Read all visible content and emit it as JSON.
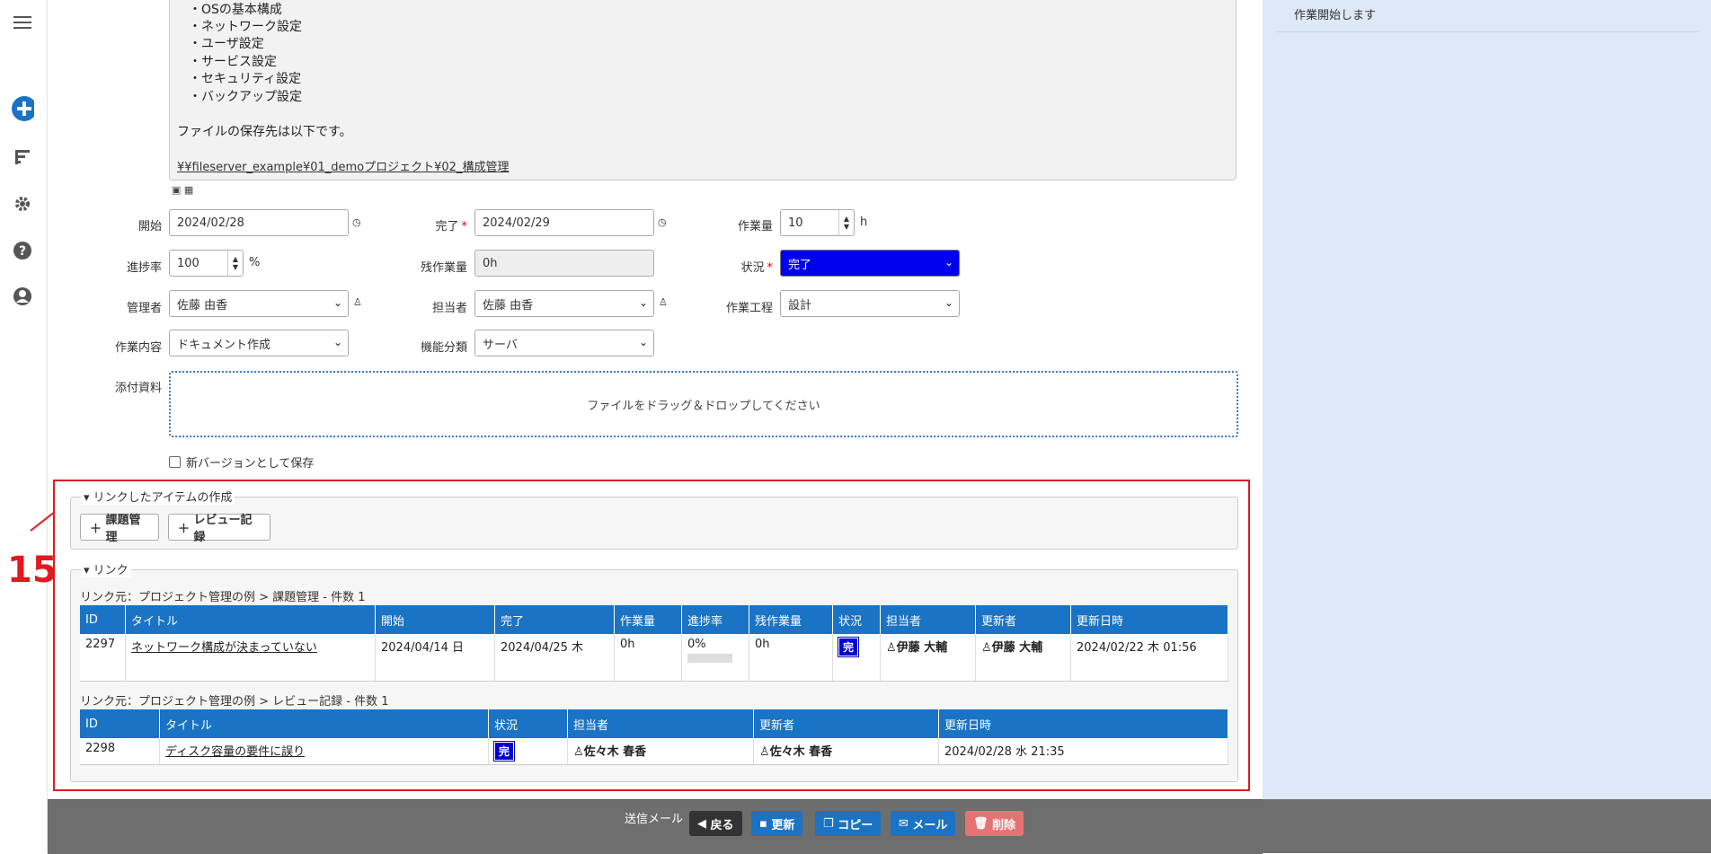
{
  "nav": {
    "icons": [
      "menu-icon",
      "add-icon",
      "gantt-icon",
      "gear-icon",
      "help-icon",
      "user-icon"
    ]
  },
  "description": {
    "lines": [
      "・OSの基本構成",
      "・ネットワーク設定",
      "・ユーザ設定",
      "・サービス設定",
      "・セキュリティ設定",
      "・バックアップ設定"
    ],
    "storage_text": "ファイルの保存先は以下です。",
    "path": "¥¥fileserver_example¥01_demoプロジェクト¥02_構成管理"
  },
  "right_panel": {
    "comment": "作業開始します"
  },
  "form": {
    "start": {
      "label": "開始",
      "value": "2024/02/28"
    },
    "end": {
      "label": "完了",
      "value": "2024/02/29"
    },
    "workload": {
      "label": "作業量",
      "value": "10",
      "unit": "h"
    },
    "progress": {
      "label": "進捗率",
      "value": "100",
      "unit": "%"
    },
    "remaining": {
      "label": "残作業量",
      "value": "0h"
    },
    "status": {
      "label": "状況",
      "value": "完了"
    },
    "manager": {
      "label": "管理者",
      "value": "佐藤 由香"
    },
    "owner": {
      "label": "担当者",
      "value": "佐藤 由香"
    },
    "process": {
      "label": "作業工程",
      "value": "設計"
    },
    "work_type": {
      "label": "作業内容",
      "value": "ドキュメント作成"
    },
    "category": {
      "label": "機能分類",
      "value": "サーバ"
    },
    "attachments": {
      "label": "添付資料",
      "drop_text": "ファイルをドラッグ＆ドロップしてください"
    },
    "new_version": {
      "label": "新バージョンとして保存"
    }
  },
  "annotation": {
    "number": "15"
  },
  "linked_create": {
    "legend": "リンクしたアイテムの作成",
    "buttons": [
      "課題管理",
      "レビュー記録"
    ]
  },
  "links": {
    "legend": "リンク",
    "issues": {
      "caption": "リンク元：プロジェクト管理の例 > 課題管理 - 件数 1",
      "headers": [
        "ID",
        "タイトル",
        "開始",
        "完了",
        "作業量",
        "進捗率",
        "残作業量",
        "状況",
        "担当者",
        "更新者",
        "更新日時"
      ],
      "row": {
        "id": "2297",
        "title": "ネットワーク構成が決まっていない",
        "start": "2024/04/14 日",
        "end": "2024/04/25 木",
        "workload": "0h",
        "progress": "0%",
        "remaining": "0h",
        "status": "完",
        "owner": "伊藤 大輔",
        "updater": "伊藤 大輔",
        "updated": "2024/02/22 木 01:56"
      }
    },
    "reviews": {
      "caption": "リンク元：プロジェクト管理の例 > レビュー記録 - 件数 1",
      "headers": [
        "ID",
        "タイトル",
        "状況",
        "担当者",
        "更新者",
        "更新日時"
      ],
      "row": {
        "id": "2298",
        "title": "ディスク容量の要件に誤り",
        "status": "完",
        "owner": "佐々木 春香",
        "updater": "佐々木 春香",
        "updated": "2024/02/28 水 21:35"
      }
    }
  },
  "toolbar": {
    "send_mail": "送信メール",
    "back": "戻る",
    "update": "更新",
    "copy": "コピー",
    "mail": "メール",
    "delete": "削除"
  },
  "colors": {
    "accent": "#1a73c4",
    "status_blue": "#0000ee",
    "highlight_red": "#e2191f",
    "delete": "#e57373"
  }
}
